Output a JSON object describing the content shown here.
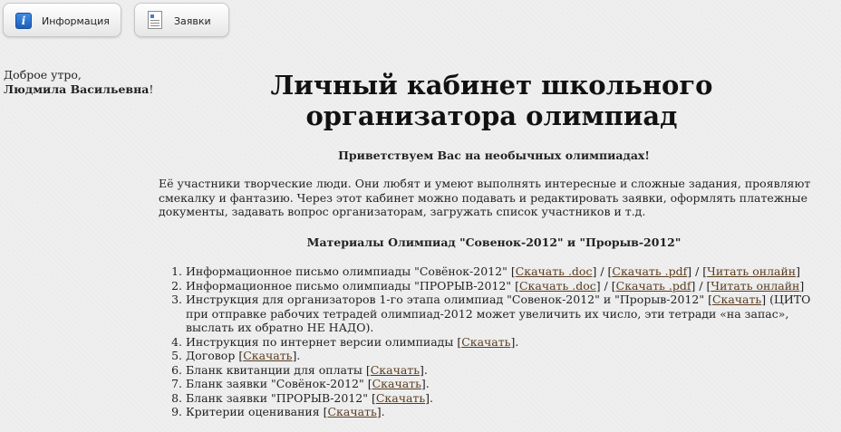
{
  "nav": {
    "info_label": "Информация",
    "apps_label": "Заявки"
  },
  "greeting": {
    "line1": "Доброе утро,",
    "name": "Людмила Васильевна",
    "suffix": "!"
  },
  "title": "Личный кабинет школьного организатора олимпиад",
  "welcome": "Приветствуем Вас на необычных олимпиадах!",
  "intro": "Её участники творческие люди. Они любят и умеют выполнять интересные и сложные задания, проявляют смекалку и фантазию. Через этот кабинет можно подавать и редактировать заявки, оформлять платежные документы, задавать вопрос организаторам, загружать список участников и т.д.",
  "materials_heading": "Материалы Олимпиад \"Совенок-2012\" и \"Прорыв-2012\"",
  "list": {
    "item1": {
      "text": "Информационное письмо олимпиады \"Совёнок-2012\" ",
      "link1": "Скачать .doc",
      "link2": "Скачать .pdf",
      "link3": "Читать онлайн"
    },
    "item2": {
      "text": "Информационное письмо олимпиады \"ПРОРЫВ-2012\" ",
      "link1": "Скачать .doc",
      "link2": "Скачать .pdf",
      "link3": "Читать онлайн"
    },
    "item3": {
      "text": "Инструкция для организаторов 1-го этапа олимпиад \"Совенок-2012\" и \"Прорыв-2012\" ",
      "link": "Скачать",
      "after": " (ЦИТО при отправке рабочих тетрадей олимпиад-2012 может увеличить их число, эти тетради «на запас», выслать их обратно НЕ НАДО)."
    },
    "item4": {
      "text": "Инструкция по интернет версии олимпиады ",
      "link": "Скачать"
    },
    "item5": {
      "text": "Договор ",
      "link": "Скачать"
    },
    "item6": {
      "text": "Бланк квитанции для оплаты ",
      "link": "Скачать"
    },
    "item7": {
      "text": "Бланк заявки \"Совёнок-2012\" ",
      "link": "Скачать"
    },
    "item8": {
      "text": "Бланк заявки \"ПРОРЫВ-2012\" ",
      "link": "Скачать"
    },
    "item9": {
      "text": "Критерии оценивания ",
      "link": "Скачать"
    }
  }
}
